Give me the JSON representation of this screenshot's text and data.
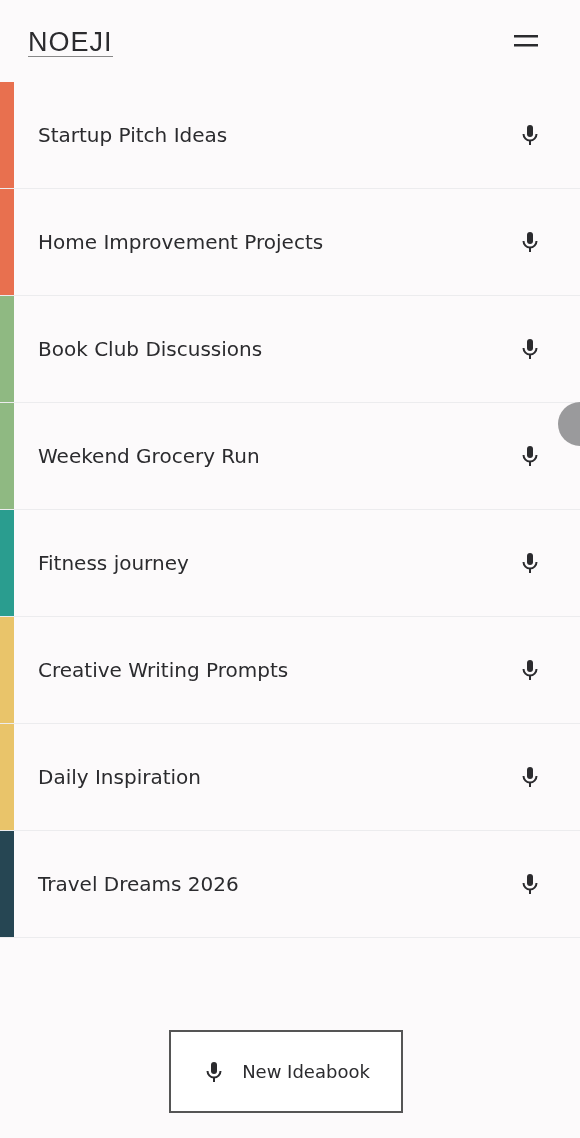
{
  "header": {
    "logo": "NOEJI"
  },
  "ideabooks": [
    {
      "title": "Startup Pitch Ideas",
      "color": "#e8704f"
    },
    {
      "title": "Home Improvement Projects",
      "color": "#e8704f"
    },
    {
      "title": "Book Club Discussions",
      "color": "#8fb982"
    },
    {
      "title": "Weekend Grocery Run",
      "color": "#8fb982"
    },
    {
      "title": "Fitness journey",
      "color": "#2a9d8f"
    },
    {
      "title": "Creative Writing Prompts",
      "color": "#e9c46a"
    },
    {
      "title": "Daily Inspiration",
      "color": "#e9c46a"
    },
    {
      "title": "Travel Dreams 2026",
      "color": "#264653"
    }
  ],
  "new_button": {
    "label": "New Ideabook"
  }
}
